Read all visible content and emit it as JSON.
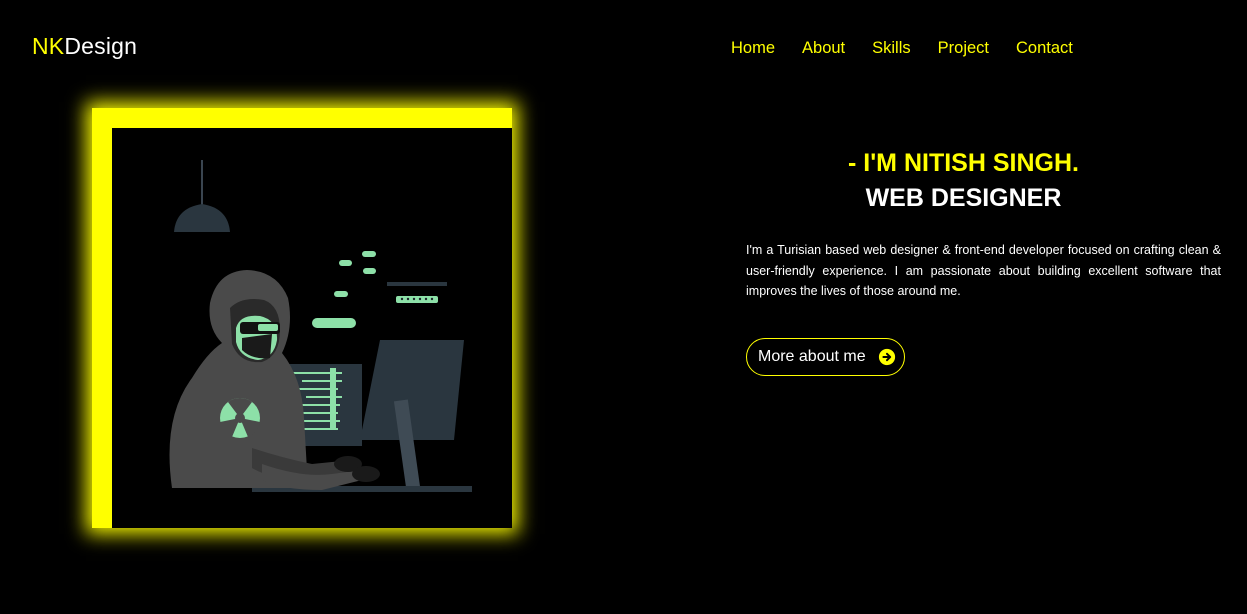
{
  "logo": {
    "part1": "NK",
    "part2": "Design"
  },
  "nav": {
    "home": "Home",
    "about": "About",
    "skills": "Skills",
    "project": "Project",
    "contact": "Contact"
  },
  "hero": {
    "title": "- I'M NITISH SINGH.",
    "subtitle": "WEB DESIGNER",
    "description": "I'm a Turisian based web designer & front-end developer focused on crafting clean & user-friendly experience. I am passionate about building excellent software that improves the lives of those around me.",
    "button": "More about me",
    "button_icon": "arrow-circle-right-icon"
  },
  "illustration": {
    "subject": "hooded-hacker-at-computer"
  },
  "colors": {
    "accent": "#ffff00",
    "background": "#000000",
    "text": "#ffffff",
    "illustration_green": "#8de0a8"
  }
}
